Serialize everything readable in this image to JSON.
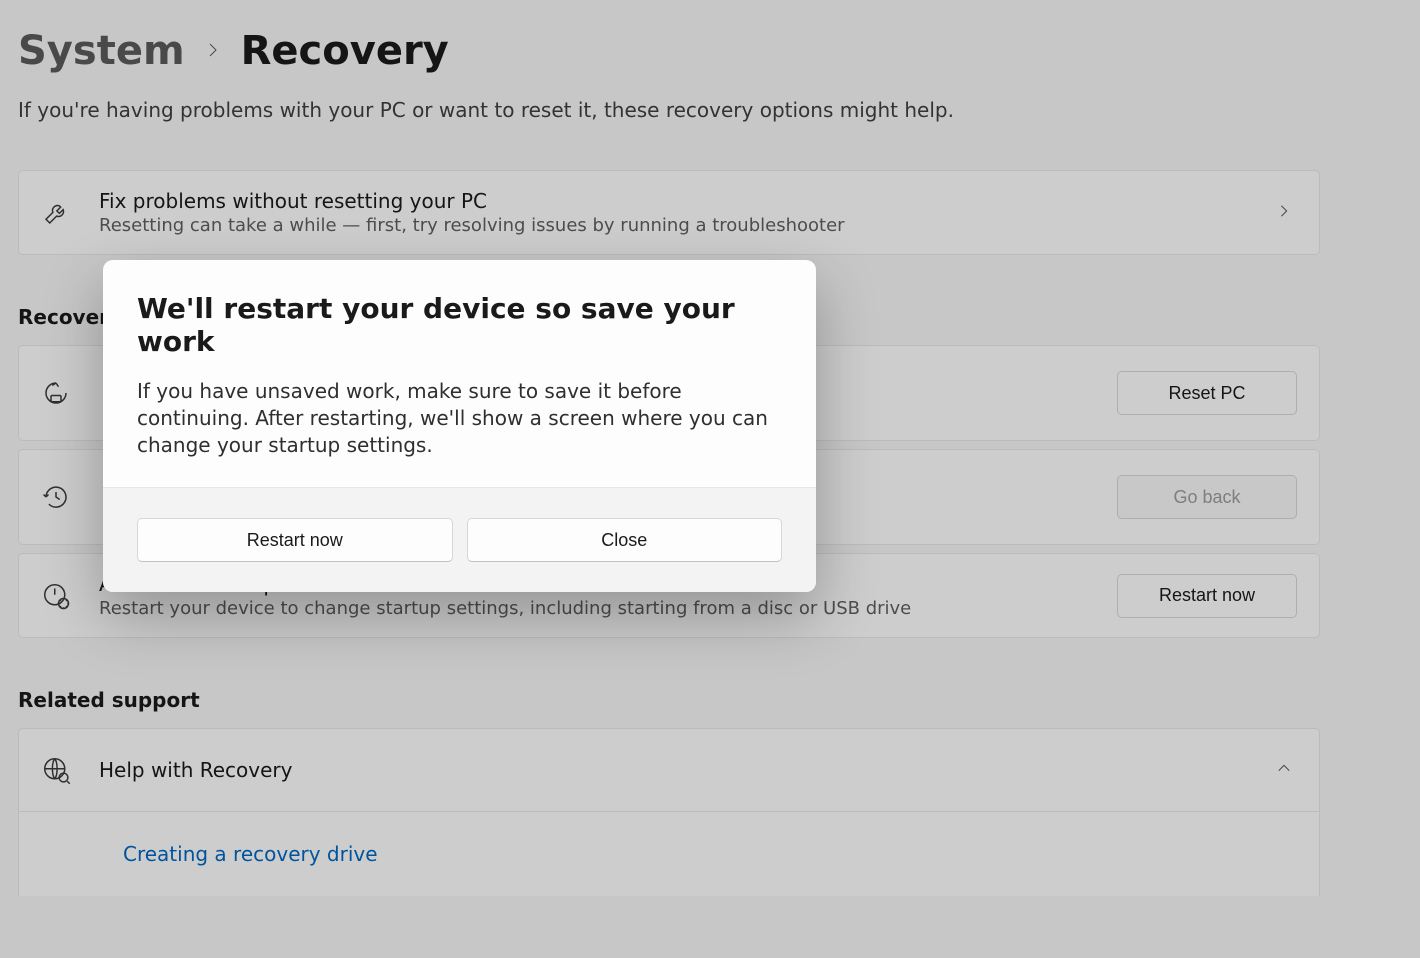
{
  "breadcrumb": {
    "parent": "System",
    "current": "Recovery"
  },
  "page_description": "If you're having problems with your PC or want to reset it, these recovery options might help.",
  "fix_card": {
    "title": "Fix problems without resetting your PC",
    "sub": "Resetting can take a while — first, try resolving issues by running a troubleshooter"
  },
  "recovery_section_label": "Recovery",
  "reset_card": {
    "button": "Reset PC"
  },
  "goback_card": {
    "button": "Go back"
  },
  "advanced_card": {
    "title": "Advanced startup",
    "sub": "Restart your device to change startup settings, including starting from a disc or USB drive",
    "button": "Restart now"
  },
  "related_section_label": "Related support",
  "help_card": {
    "title": "Help with Recovery"
  },
  "help_link": "Creating a recovery drive",
  "dialog": {
    "title": "We'll restart your device so save your work",
    "body": "If you have unsaved work, make sure to save it before continuing. After restarting, we'll show a screen where you can change your startup settings.",
    "restart_label": "Restart now",
    "close_label": "Close"
  }
}
